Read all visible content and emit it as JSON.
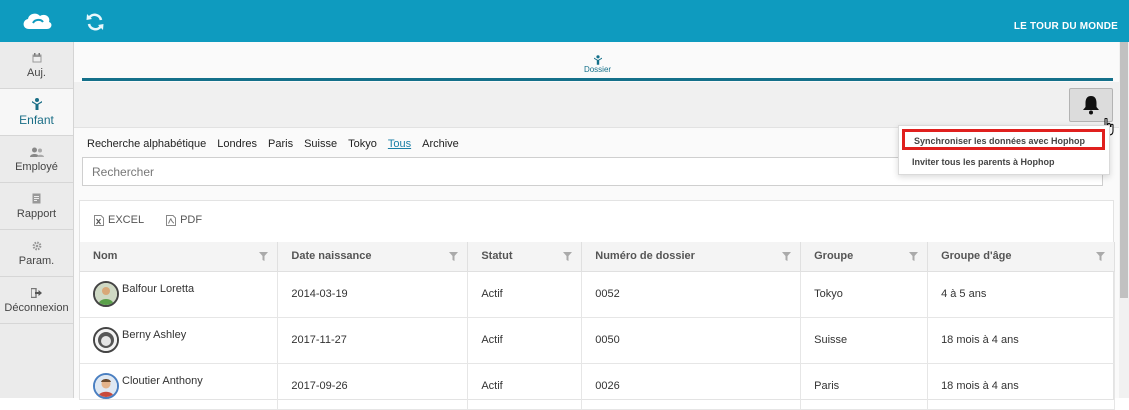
{
  "app": {
    "org_name": "LE TOUR DU MONDE",
    "accent_color": "#0e9bbf",
    "logo_icon": "cloud-logo-icon",
    "refresh_icon": "refresh-icon"
  },
  "sidebar": {
    "items": [
      {
        "label": "Auj.",
        "icon": "calendar-icon",
        "active": false
      },
      {
        "label": "Enfant",
        "icon": "child-icon",
        "active": true
      },
      {
        "label": "Employé",
        "icon": "employees-icon",
        "active": false
      },
      {
        "label": "Rapport",
        "icon": "report-icon",
        "active": false
      },
      {
        "label": "Param.",
        "icon": "gear-icon",
        "active": false
      },
      {
        "label": "Déconnexion",
        "icon": "logout-icon",
        "active": false
      }
    ]
  },
  "tabs": {
    "dossier_label": "Dossier"
  },
  "filters": {
    "items": [
      "Recherche alphabétique",
      "Londres",
      "Paris",
      "Suisse",
      "Tokyo",
      "Tous",
      "Archive"
    ],
    "active": "Tous"
  },
  "search": {
    "placeholder": "Rechercher"
  },
  "exports": {
    "excel_label": "EXCEL",
    "pdf_label": "PDF"
  },
  "table": {
    "columns": [
      "Nom",
      "Date naissance",
      "Statut",
      "Numéro de dossier",
      "Groupe",
      "Groupe d'âge"
    ],
    "rows": [
      {
        "nom": "Balfour Loretta",
        "date": "2014-03-19",
        "statut": "Actif",
        "dossier": "0052",
        "groupe": "Tokyo",
        "age": "4 à 5 ans"
      },
      {
        "nom": "Berny Ashley",
        "date": "2017-11-27",
        "statut": "Actif",
        "dossier": "0050",
        "groupe": "Suisse",
        "age": "18 mois à 4 ans"
      },
      {
        "nom": "Cloutier Anthony",
        "date": "2017-09-26",
        "statut": "Actif",
        "dossier": "0026",
        "groupe": "Paris",
        "age": "18 mois à 4 ans"
      }
    ]
  },
  "notifications": {
    "bell_icon": "bell-icon",
    "menu": {
      "sync_label": "Synchroniser les données avec Hophop",
      "invite_label": "Inviter tous les parents à Hophop",
      "highlight_color": "#e0201e"
    }
  }
}
